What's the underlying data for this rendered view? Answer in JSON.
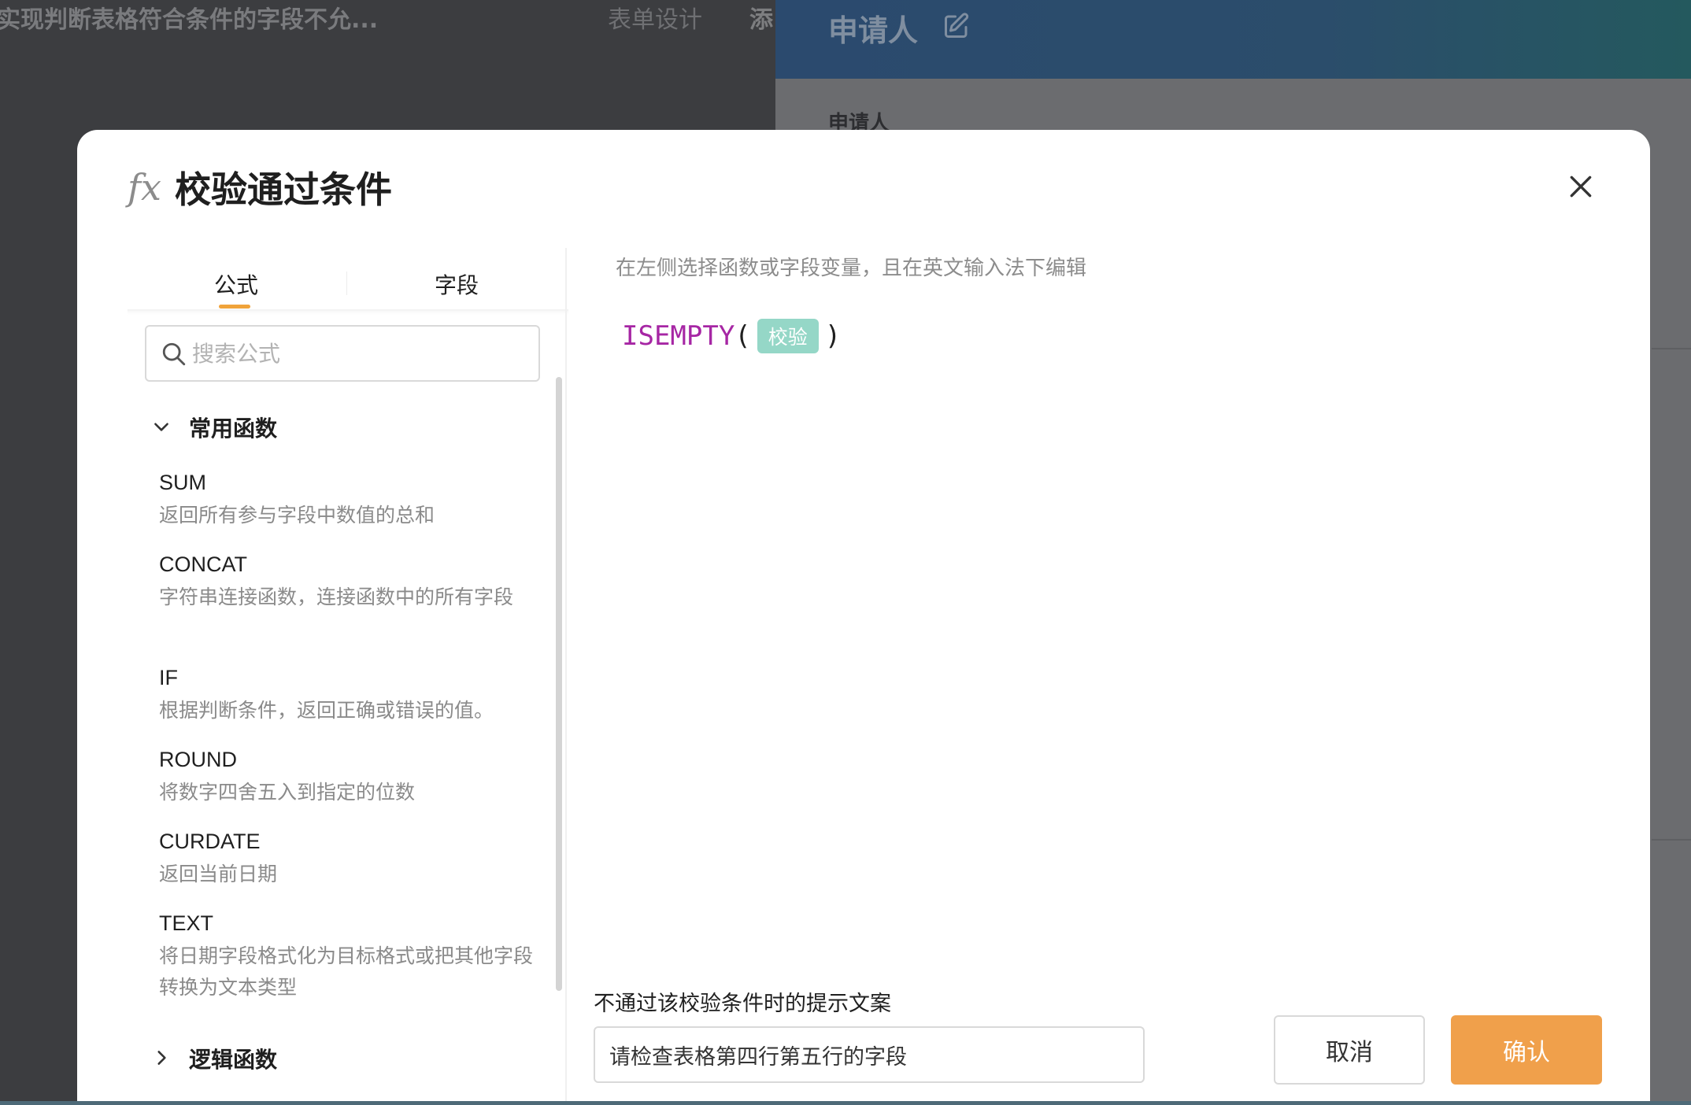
{
  "background": {
    "page_title": "实现判断表格符合条件的字段不允...",
    "tab_design": "表单设计",
    "tab_add_partial": "添",
    "banner_title": "申请人",
    "section_label": "申请人"
  },
  "modal": {
    "icon_text": "fx",
    "title": "校验通过条件",
    "tabs": {
      "formula": "公式",
      "field": "字段",
      "active": "formula"
    },
    "search": {
      "placeholder": "搜索公式",
      "value": ""
    },
    "groups": [
      {
        "label": "常用函数",
        "expanded": true,
        "functions": [
          {
            "name": "SUM",
            "desc": "返回所有参与字段中数值的总和"
          },
          {
            "name": "CONCAT",
            "desc": "字符串连接函数，连接函数中的所有字段"
          },
          {
            "name": "IF",
            "desc": "根据判断条件，返回正确或错误的值。"
          },
          {
            "name": "ROUND",
            "desc": "将数字四舍五入到指定的位数"
          },
          {
            "name": "CURDATE",
            "desc": "返回当前日期"
          },
          {
            "name": "TEXT",
            "desc": "将日期字段格式化为目标格式或把其他字段转换为文本类型"
          }
        ]
      },
      {
        "label": "逻辑函数",
        "expanded": false
      }
    ],
    "editor": {
      "hint": "在左侧选择函数或字段变量，且在英文输入法下编辑",
      "function": "ISEMPTY",
      "open_paren": "(",
      "field_chip": "校验",
      "close_paren": ")"
    },
    "tip": {
      "label": "不通过该校验条件时的提示文案",
      "value": "请检查表格第四行第五行的字段"
    },
    "buttons": {
      "cancel": "取消",
      "confirm": "确认"
    }
  },
  "colors": {
    "accent": "#f0a04b",
    "function_token": "#a626a4",
    "field_chip": "#95d7c7",
    "tab_underline": "#f0a33a"
  }
}
